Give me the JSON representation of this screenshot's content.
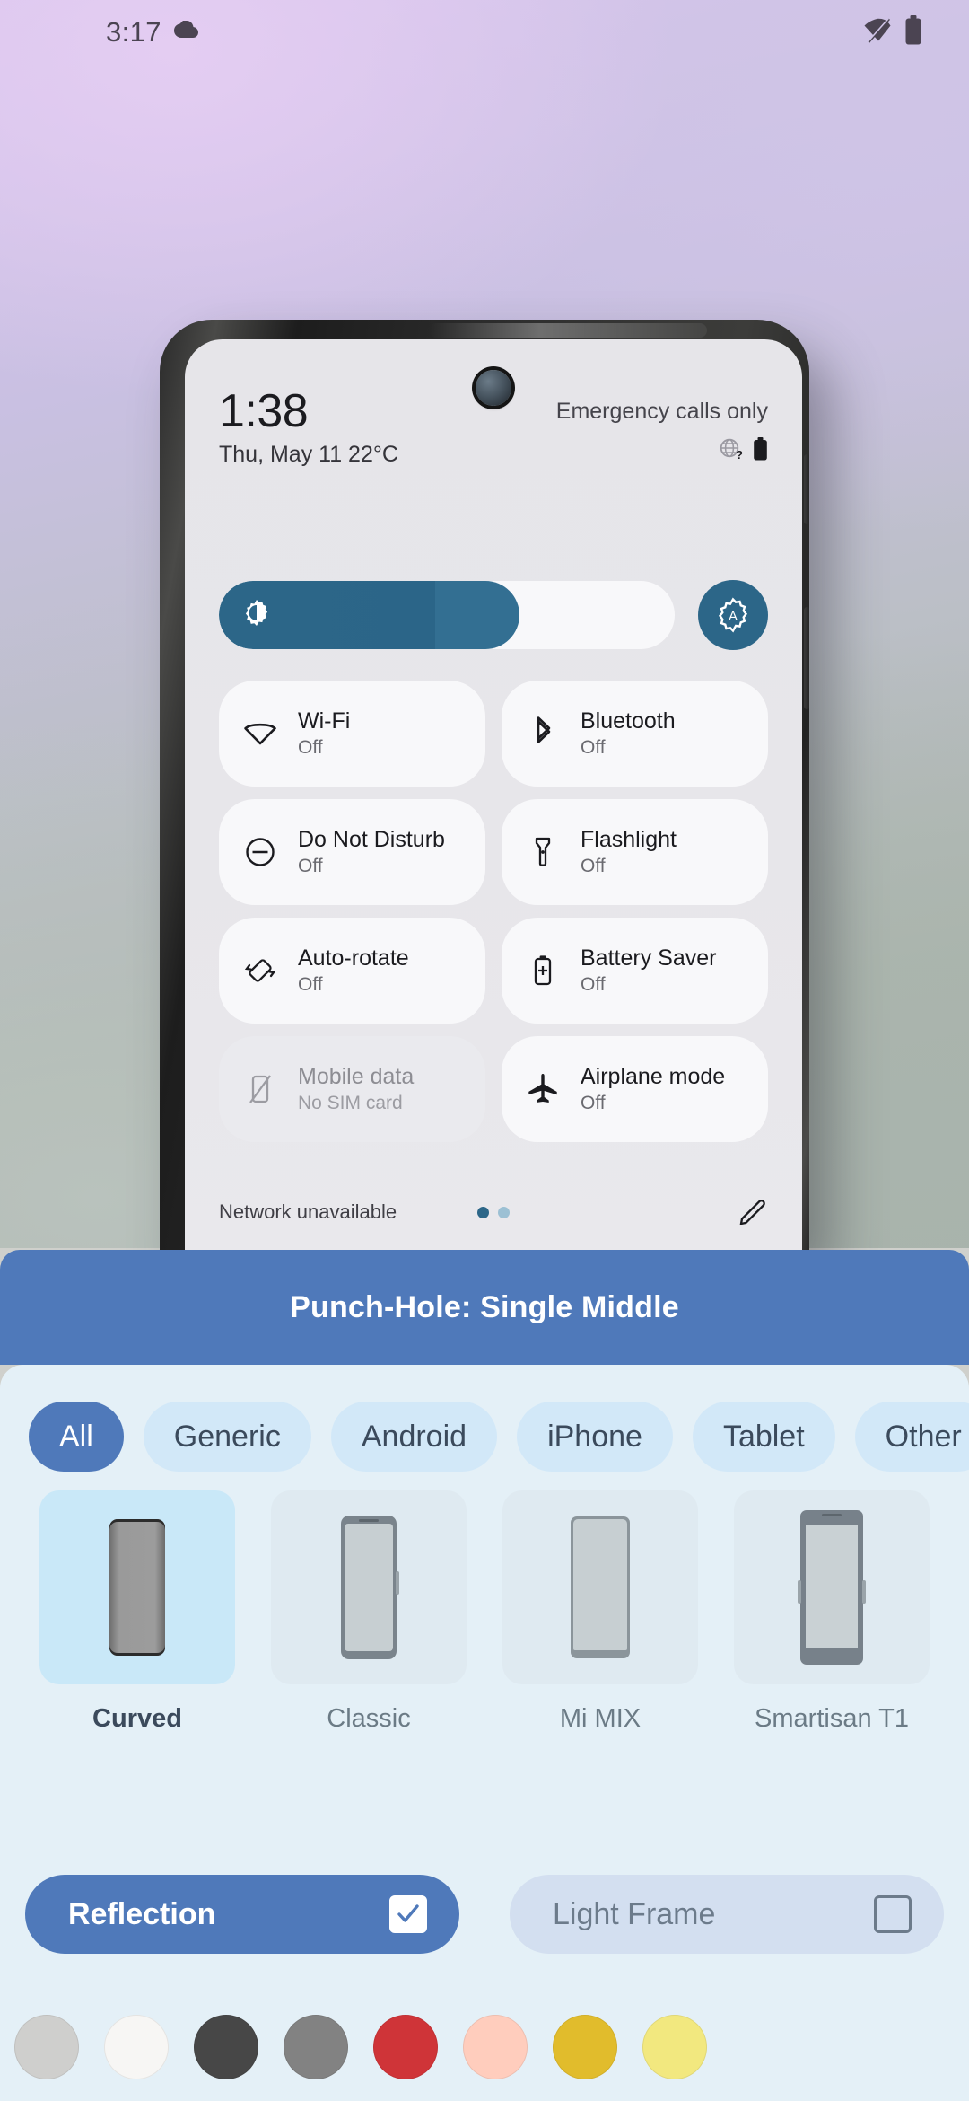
{
  "status_bar": {
    "time": "3:17",
    "left_icons": [
      "cloud-icon"
    ],
    "right_icons": [
      "wifi-off-icon",
      "battery-icon"
    ]
  },
  "mockup": {
    "quick_settings": {
      "clock": "1:38",
      "date_weather": "Thu, May 11 22°C",
      "carrier_status": "Emergency calls only",
      "header_icons": [
        "globe-question-icon",
        "battery-icon"
      ],
      "brightness": {
        "icon": "brightness-icon",
        "value_percent": 66,
        "auto_button_icon": "auto-brightness-icon",
        "auto_button_label": "A"
      },
      "tiles": [
        {
          "icon": "wifi-icon",
          "label": "Wi-Fi",
          "state": "Off",
          "enabled": true
        },
        {
          "icon": "bluetooth-icon",
          "label": "Bluetooth",
          "state": "Off",
          "enabled": true
        },
        {
          "icon": "do-not-disturb-icon",
          "label": "Do Not Disturb",
          "state": "Off",
          "enabled": true
        },
        {
          "icon": "flashlight-icon",
          "label": "Flashlight",
          "state": "Off",
          "enabled": true
        },
        {
          "icon": "auto-rotate-icon",
          "label": "Auto-rotate",
          "state": "Off",
          "enabled": true
        },
        {
          "icon": "battery-saver-icon",
          "label": "Battery Saver",
          "state": "Off",
          "enabled": true
        },
        {
          "icon": "mobile-data-off-icon",
          "label": "Mobile data",
          "state": "No SIM card",
          "enabled": false
        },
        {
          "icon": "airplane-icon",
          "label": "Airplane mode",
          "state": "Off",
          "enabled": true
        }
      ],
      "footer": {
        "status": "Network unavailable",
        "page_dots": {
          "count": 2,
          "active_index": 0
        },
        "edit_icon": "pencil-icon"
      }
    }
  },
  "banner": {
    "title": "Punch-Hole: Single Middle",
    "color": "#4f79ba"
  },
  "panel": {
    "chips": [
      {
        "label": "All",
        "selected": true
      },
      {
        "label": "Generic",
        "selected": false
      },
      {
        "label": "Android",
        "selected": false
      },
      {
        "label": "iPhone",
        "selected": false
      },
      {
        "label": "Tablet",
        "selected": false
      },
      {
        "label": "Other",
        "selected": false
      }
    ],
    "devices": [
      {
        "name": "Curved",
        "selected": true,
        "style": "curved"
      },
      {
        "name": "Classic",
        "selected": false,
        "style": "classic"
      },
      {
        "name": "Mi MIX",
        "selected": false,
        "style": "mix"
      },
      {
        "name": "Smartisan T1",
        "selected": false,
        "style": "t1"
      }
    ],
    "options": [
      {
        "label": "Reflection",
        "checked": true
      },
      {
        "label": "Light Frame",
        "checked": false
      }
    ],
    "swatches": [
      "#cfcfcd",
      "#f7f6f4",
      "#474747",
      "#828282",
      "#cf3438",
      "#ffcdbd",
      "#e1bc2c",
      "#f2e87f"
    ]
  }
}
